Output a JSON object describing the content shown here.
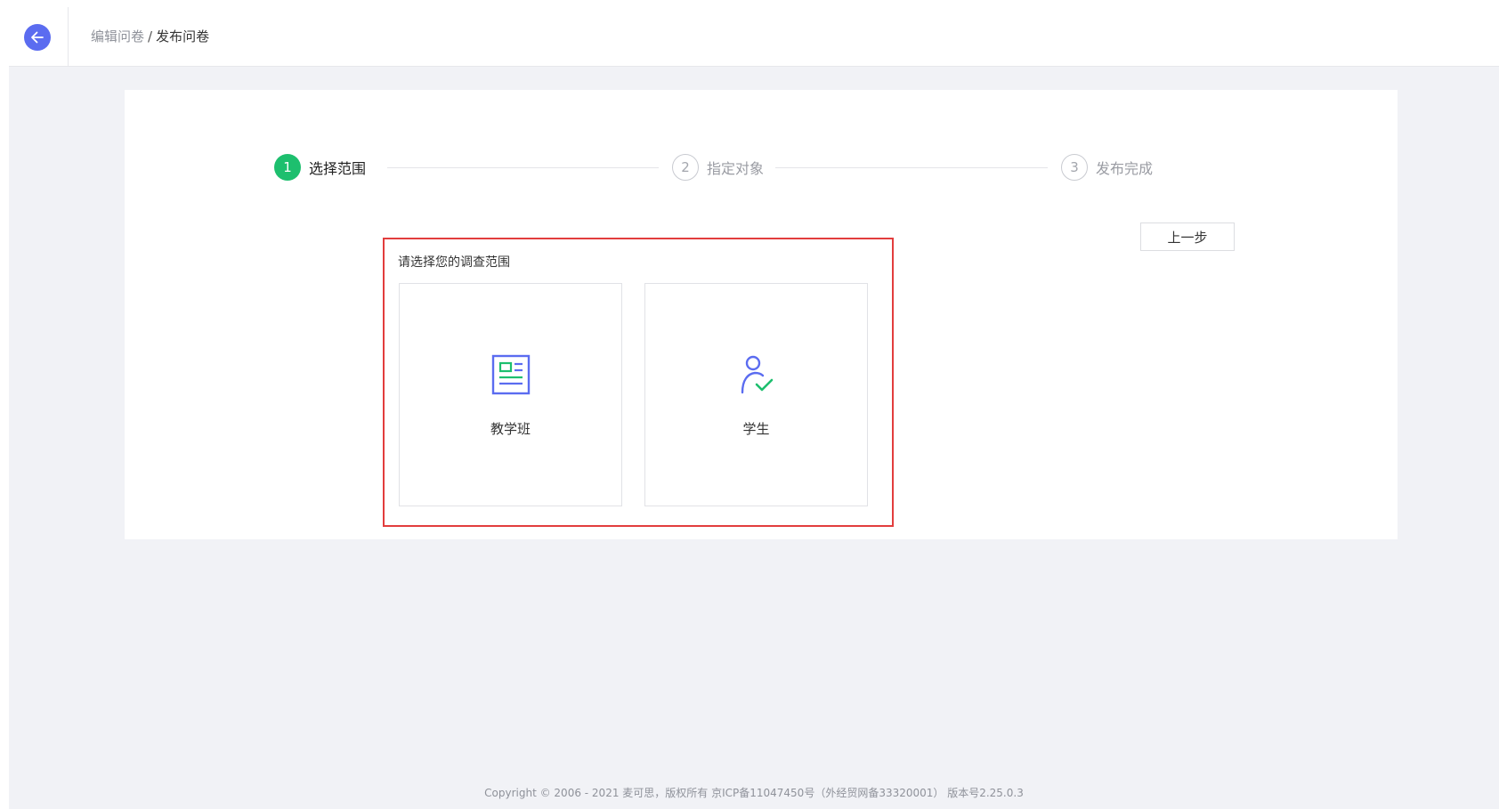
{
  "header": {
    "breadcrumb": {
      "parent": "编辑问卷",
      "separator": "/",
      "current": "发布问卷"
    }
  },
  "steps": [
    {
      "number": "1",
      "label": "选择范围",
      "state": "active"
    },
    {
      "number": "2",
      "label": "指定对象",
      "state": "pending"
    },
    {
      "number": "3",
      "label": "发布完成",
      "state": "pending"
    }
  ],
  "main": {
    "prev_label": "上一步",
    "section_title": "请选择您的调查范围",
    "options": [
      {
        "label": "教学班",
        "icon": "class-card-icon"
      },
      {
        "label": "学生",
        "icon": "student-check-icon"
      }
    ]
  },
  "footer": {
    "text": "Copyright © 2006 - 2021 麦可思，版权所有 京ICP备11047450号（外经贸网备33320001） 版本号2.25.0.3"
  },
  "colors": {
    "accent": "#5b6cf0",
    "success": "#1dbf6e",
    "highlight": "#e23d3d"
  }
}
